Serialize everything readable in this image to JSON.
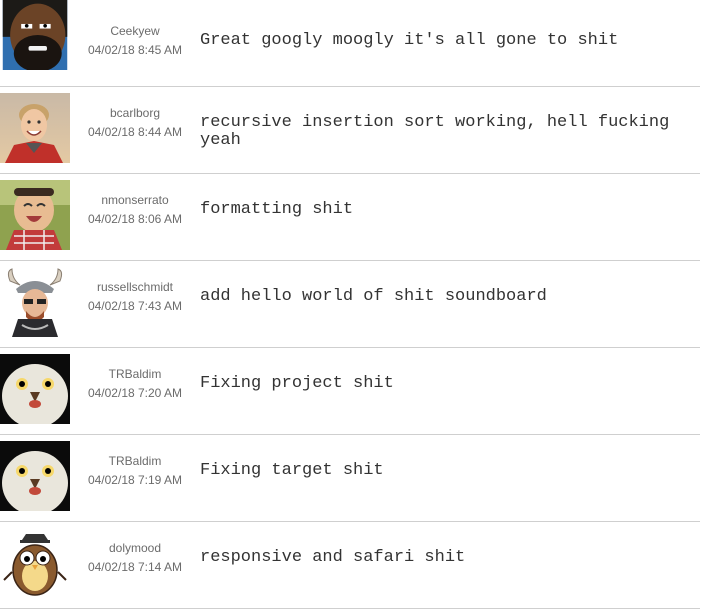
{
  "commits": [
    {
      "username": "Ceekyew",
      "time": "04/02/18 8:45 AM",
      "message": "Great googly moogly it's all gone to shit",
      "avatar": "bearded-man-avatar"
    },
    {
      "username": "bcarlborg",
      "time": "04/02/18 8:44 AM",
      "message": "recursive insertion sort working, hell fucking yeah",
      "avatar": "smiling-man-avatar"
    },
    {
      "username": "nmonserrato",
      "time": "04/02/18 8:06 AM",
      "message": "formatting shit",
      "avatar": "laughing-baby-avatar"
    },
    {
      "username": "russellschmidt",
      "time": "04/02/18 7:43 AM",
      "message": "add hello world of shit soundboard",
      "avatar": "viking-avatar"
    },
    {
      "username": "TRBaldim",
      "time": "04/02/18 7:20 AM",
      "message": "Fixing project shit",
      "avatar": "owl-avatar"
    },
    {
      "username": "TRBaldim",
      "time": "04/02/18 7:19 AM",
      "message": "Fixing target shit",
      "avatar": "owl-avatar"
    },
    {
      "username": "dolymood",
      "time": "04/02/18 7:14 AM",
      "message": "responsive and safari shit",
      "avatar": "cartoon-owl-avatar"
    }
  ]
}
